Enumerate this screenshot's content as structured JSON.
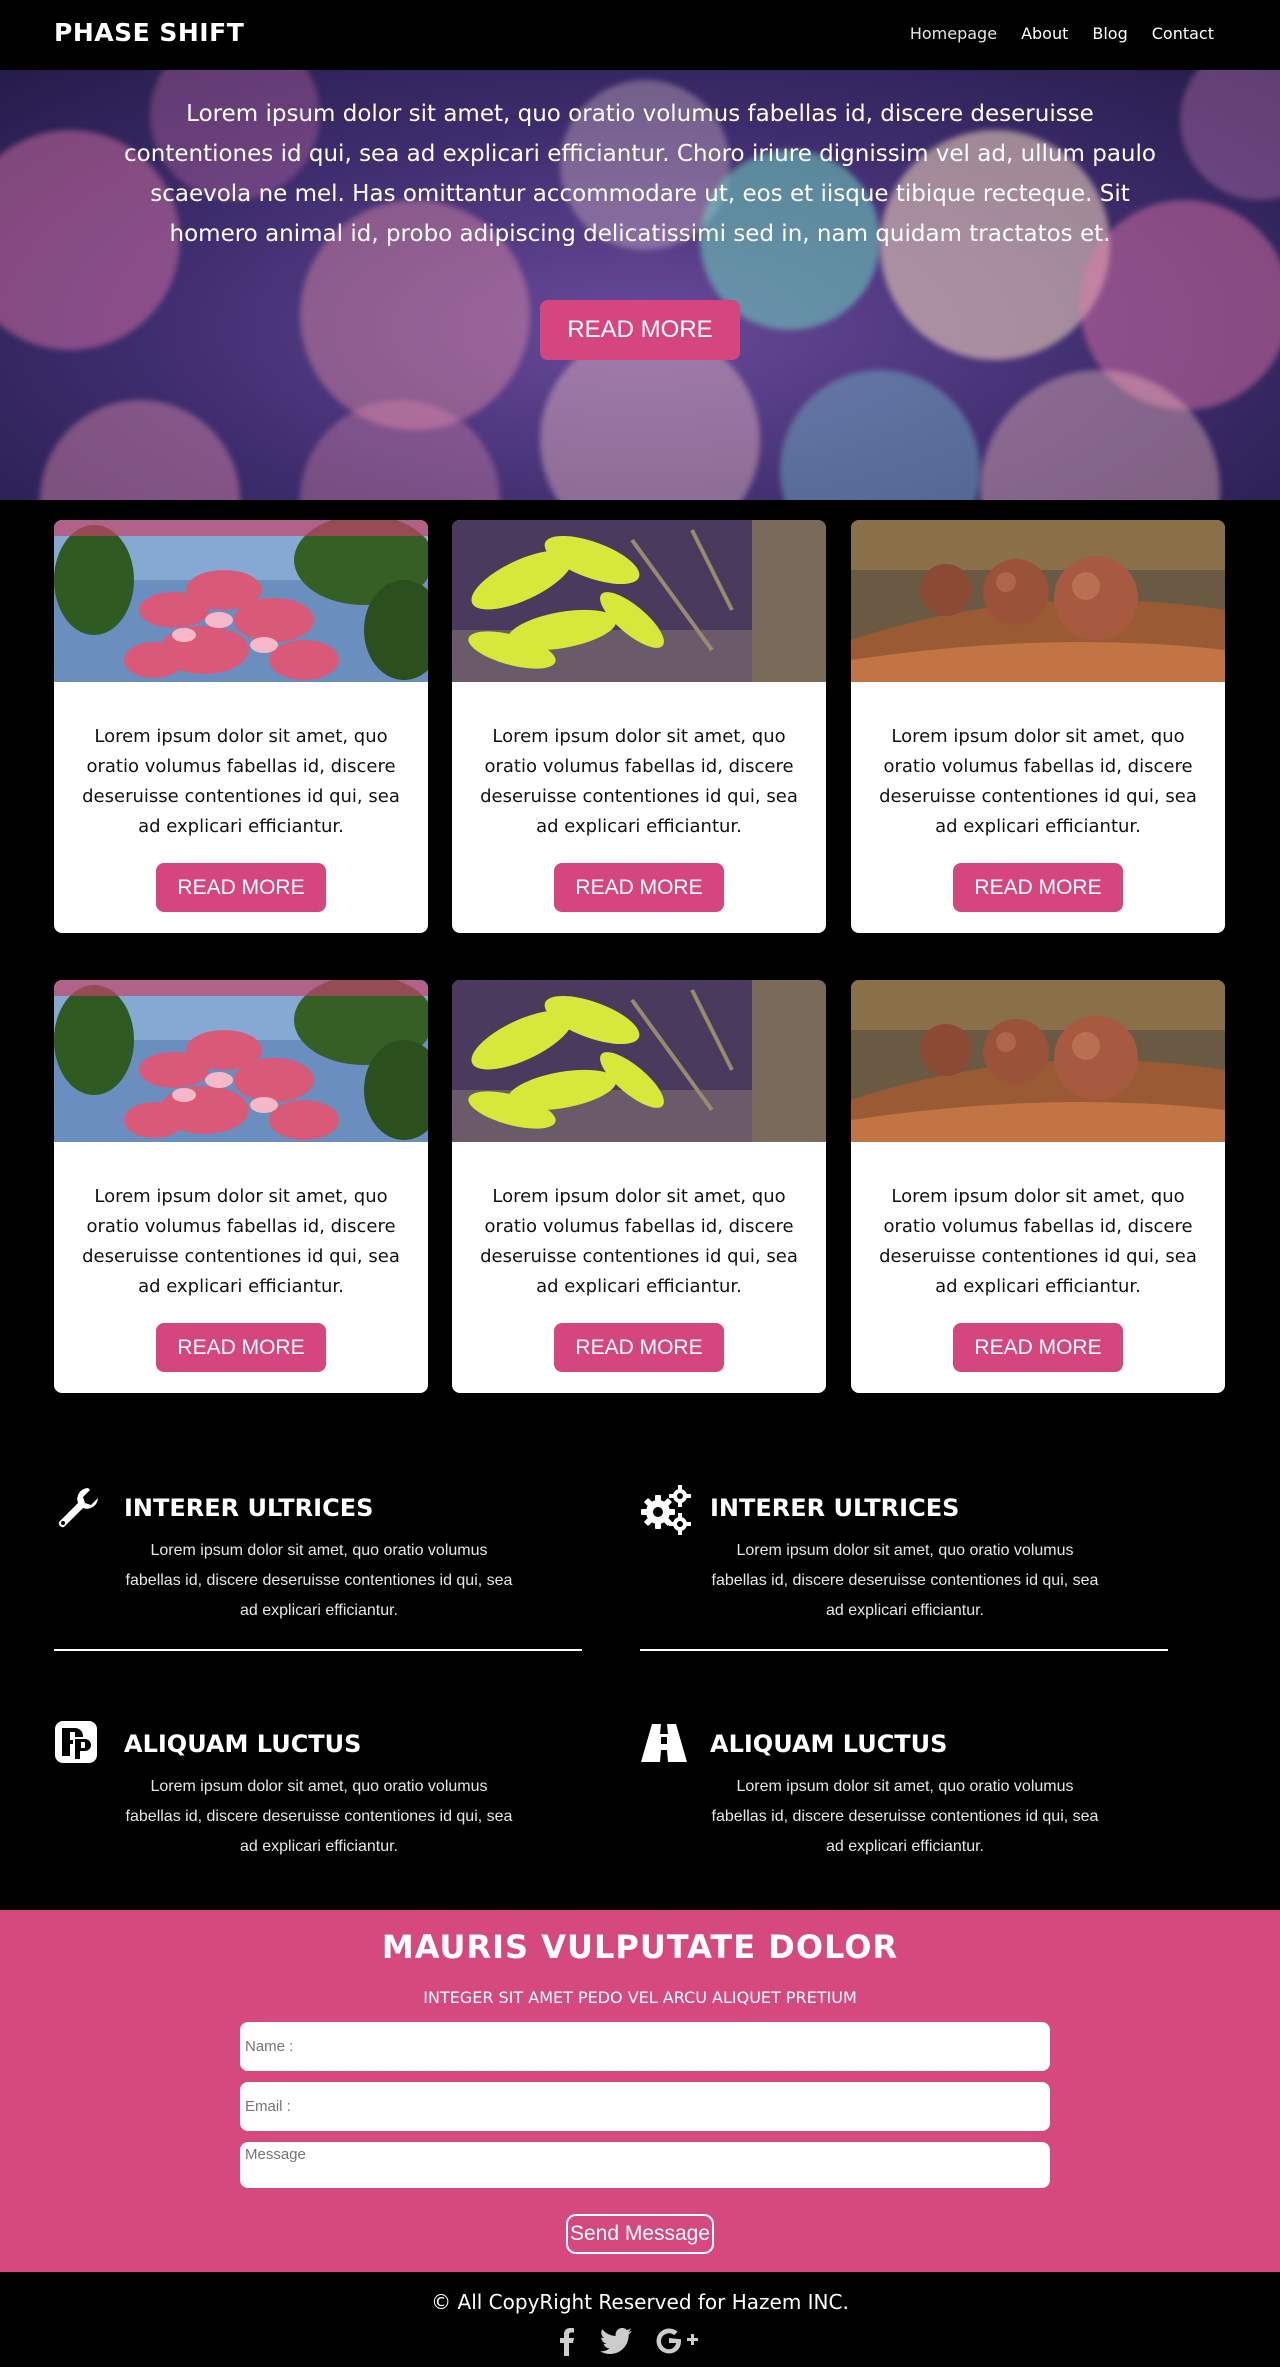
{
  "header": {
    "logo": "PHASE SHIFT",
    "nav": [
      "Homepage",
      "About",
      "Blog",
      "Contact"
    ]
  },
  "hero": {
    "text": "Lorem ipsum dolor sit amet, quo oratio volumus fabellas id, discere deseruisse contentiones id qui, sea ad explicari efficiantur. Choro iriure dignissim vel ad, ullum paulo scaevola ne mel. Has omittantur accommodare ut, eos et iisque tibique recteque. Sit homero animal id, probo adipiscing delicatissimi sed in, nam quidam tractatos et.",
    "button": "READ MORE"
  },
  "cards": [
    {
      "image": "pink-flower-photo",
      "text": "Lorem ipsum dolor sit amet, quo oratio volumus fabellas id, discere deseruisse contentiones id qui, sea ad explicari efficiantur.",
      "button": "READ MORE"
    },
    {
      "image": "yellow-leaves-photo",
      "text": "Lorem ipsum dolor sit amet, quo oratio volumus fabellas id, discere deseruisse contentiones id qui, sea ad explicari efficiantur.",
      "button": "READ MORE"
    },
    {
      "image": "seed-pods-photo",
      "text": "Lorem ipsum dolor sit amet, quo oratio volumus fabellas id, discere deseruisse contentiones id qui, sea ad explicari efficiantur.",
      "button": "READ MORE"
    },
    {
      "image": "pink-flower-photo",
      "text": "Lorem ipsum dolor sit amet, quo oratio volumus fabellas id, discere deseruisse contentiones id qui, sea ad explicari efficiantur.",
      "button": "READ MORE"
    },
    {
      "image": "yellow-leaves-photo",
      "text": "Lorem ipsum dolor sit amet, quo oratio volumus fabellas id, discere deseruisse contentiones id qui, sea ad explicari efficiantur.",
      "button": "READ MORE"
    },
    {
      "image": "seed-pods-photo",
      "text": "Lorem ipsum dolor sit amet, quo oratio volumus fabellas id, discere deseruisse contentiones id qui, sea ad explicari efficiantur.",
      "button": "READ MORE"
    }
  ],
  "features": [
    {
      "icon": "wrench-icon",
      "title": "INTERER ULTRICES",
      "text": "Lorem ipsum dolor sit amet, quo oratio volumus fabellas id, discere deseruisse contentiones id qui, sea ad explicari efficiantur."
    },
    {
      "icon": "gears-icon",
      "title": "INTERER ULTRICES",
      "text": "Lorem ipsum dolor sit amet, quo oratio volumus fabellas id, discere deseruisse contentiones id qui, sea ad explicari efficiantur."
    },
    {
      "icon": "product-hunt-icon",
      "title": "ALIQUAM LUCTUS",
      "text": "Lorem ipsum dolor sit amet, quo oratio volumus fabellas id, discere deseruisse contentiones id qui, sea ad explicari efficiantur."
    },
    {
      "icon": "road-icon",
      "title": "ALIQUAM LUCTUS",
      "text": "Lorem ipsum dolor sit amet, quo oratio volumus fabellas id, discere deseruisse contentiones id qui, sea ad explicari efficiantur."
    }
  ],
  "contact": {
    "title": "MAURIS VULPUTATE DOLOR",
    "subtitle": "INTEGER SIT AMET PEDO VEL ARCU ALIQUET PRETIUM",
    "name_placeholder": "Name :",
    "email_placeholder": "Email :",
    "message_placeholder": "Message",
    "send_button": "Send Message"
  },
  "footer": {
    "copyright": "© All CopyRight Reserved for Hazem INC.",
    "socials": [
      "facebook-icon",
      "twitter-icon",
      "google-plus-icon"
    ]
  },
  "colors": {
    "accent": "#d6467e",
    "background": "#000000",
    "card_background": "#ffffff"
  }
}
